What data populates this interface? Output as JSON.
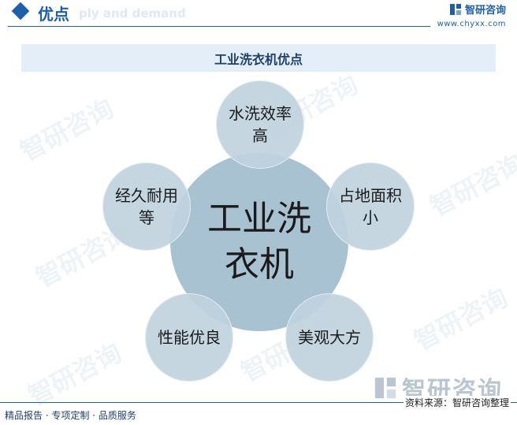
{
  "header": {
    "title": "优点",
    "ghost_text": "ply and demand"
  },
  "brand": {
    "name": "智研咨询",
    "url": "www.chyxx.com"
  },
  "banner": {
    "title": "工业洗衣机优点"
  },
  "diagram": {
    "center": "工业洗衣机",
    "advantages": [
      "水洗效率高",
      "占地面积小",
      "美观大方",
      "性能优良",
      "经久耐用等"
    ]
  },
  "watermark": {
    "text": "智研咨询"
  },
  "footer": {
    "left_text": "精品报告 · 专项定制 · 品质服务",
    "brand_name": "智研咨询",
    "source": "资料来源：智研咨询整理"
  },
  "colors": {
    "primary": "#1f5fa8",
    "center_circle": "#a9c2d2",
    "outer_circle": "#c0d2de",
    "banner_bg": "#e3eef8"
  }
}
